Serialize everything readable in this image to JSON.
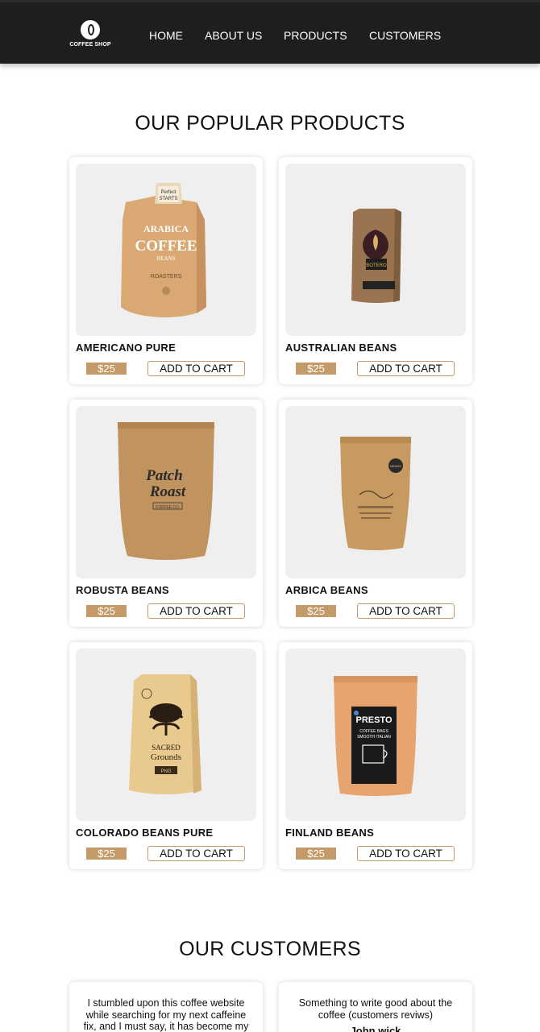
{
  "header": {
    "logo_text": "COFFEE SHOP",
    "nav": [
      "HOME",
      "ABOUT US",
      "PRODUCTS",
      "CUSTOMERS"
    ]
  },
  "products_section": {
    "title": "OUR POPULAR PRODUCTS",
    "items": [
      {
        "name": "AMERICANO PURE",
        "price": "$25",
        "button": "ADD TO CART",
        "image": "arabica-coffee-bag-image"
      },
      {
        "name": "AUSTRALIAN BEANS",
        "price": "$25",
        "button": "ADD TO CART",
        "image": "boteao-coffee-bag-image"
      },
      {
        "name": "ROBUSTA BEANS",
        "price": "$25",
        "button": "ADD TO CART",
        "image": "patch-roast-bag-image"
      },
      {
        "name": "ARBICA BEANS",
        "price": "$25",
        "button": "ADD TO CART",
        "image": "kraft-pouch-image"
      },
      {
        "name": "COLORADO BEANS PURE",
        "price": "$25",
        "button": "ADD TO CART",
        "image": "sacred-grounds-bag-image"
      },
      {
        "name": "FINLAND BEANS",
        "price": "$25",
        "button": "ADD TO CART",
        "image": "presto-coffee-bags-image"
      }
    ]
  },
  "customers_section": {
    "title": "OUR CUSTOMERS",
    "reviews": [
      {
        "text": "I stumbled upon this coffee website while searching for my next caffeine fix, and I must say, it has become my",
        "author": ""
      },
      {
        "text": "Something to write good about the coffee (customers reviws)",
        "author": "John wick"
      }
    ]
  },
  "colors": {
    "header_bg": "#1e1e1e",
    "accent": "#c39a68",
    "image_bg": "#efefef"
  }
}
